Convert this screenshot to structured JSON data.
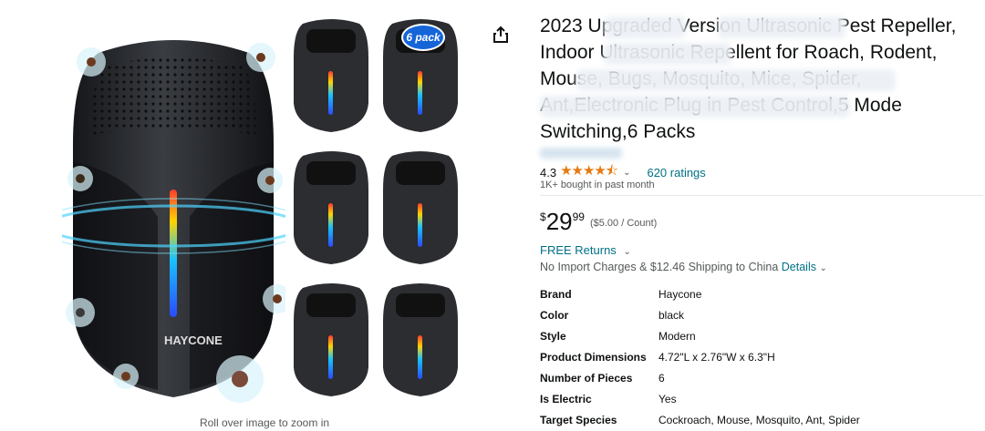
{
  "product": {
    "title_lines": [
      "2023 Upgraded Version Ultrasonic Pest Repeller,",
      "Indoor Ultrasonic Repellent for Roach, Rodent,",
      "Mouse, Bugs, Mosquito, Mice, Spider,",
      "Ant,Electronic Plug in Pest Control,5 Mode",
      "Switching,6 Packs"
    ],
    "rating": "4.3",
    "ratings_count": "620 ratings",
    "bought": "1K+ bought in past month",
    "price_symbol": "$",
    "price_whole": "29",
    "price_fraction": "99",
    "price_per_unit": "($5.00 / Count)",
    "free_returns": "FREE Returns",
    "shipping_text": "No Import Charges & $12.46 Shipping to China",
    "shipping_details_link": "Details",
    "specs": [
      {
        "key": "Brand",
        "value": "Haycone"
      },
      {
        "key": "Color",
        "value": "black"
      },
      {
        "key": "Style",
        "value": "Modern"
      },
      {
        "key": "Product Dimensions",
        "value": "4.72\"L x 2.76\"W x 6.3\"H"
      },
      {
        "key": "Number of Pieces",
        "value": "6"
      },
      {
        "key": "Is Electric",
        "value": "Yes"
      },
      {
        "key": "Target Species",
        "value": "Cockroach, Mouse, Mosquito, Ant, Spider"
      }
    ]
  },
  "gallery": {
    "zoom_hint": "Roll over image to zoom in",
    "badge": "6 pack",
    "device_logo": "HAYCONE"
  },
  "icons": {
    "share": "share-icon",
    "star": "star-icon",
    "chevron": "chevron-down-icon"
  },
  "colors": {
    "link": "#007185",
    "star": "#e47911",
    "text": "#0f1111",
    "muted": "#565959",
    "device": "#2b2d30",
    "badge": "#1565d8"
  }
}
